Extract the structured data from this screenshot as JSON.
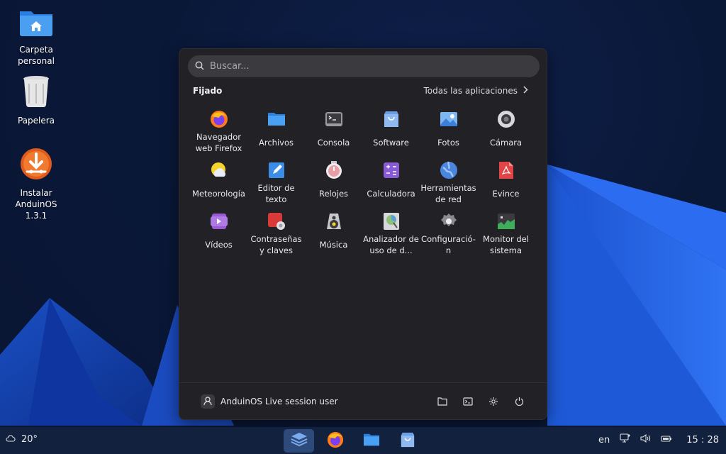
{
  "desktop": {
    "icons": [
      {
        "label": "Carpeta personal",
        "icon": "home-folder-icon"
      },
      {
        "label": "Papelera",
        "icon": "trash-icon"
      },
      {
        "label": "Instalar AnduinOS 1.3.1",
        "icon": "installer-icon"
      }
    ]
  },
  "menu": {
    "search": {
      "placeholder": "Buscar...",
      "value": ""
    },
    "section_title": "Fijado",
    "all_apps_label": "Todas las aplicaciones",
    "apps": [
      {
        "label": "Navegador web Firefox",
        "icon": "firefox-icon"
      },
      {
        "label": "Archivos",
        "icon": "files-icon"
      },
      {
        "label": "Consola",
        "icon": "console-icon"
      },
      {
        "label": "Software",
        "icon": "software-icon"
      },
      {
        "label": "Fotos",
        "icon": "photos-icon"
      },
      {
        "label": "Cámara",
        "icon": "camera-icon"
      },
      {
        "label": "Meteorología",
        "icon": "weather-icon"
      },
      {
        "label": "Editor de texto",
        "icon": "text-editor-icon"
      },
      {
        "label": "Relojes",
        "icon": "clocks-icon"
      },
      {
        "label": "Calculadora",
        "icon": "calculator-icon"
      },
      {
        "label": "Herramientas de red",
        "icon": "network-tools-icon"
      },
      {
        "label": "Evince",
        "icon": "document-viewer-icon"
      },
      {
        "label": "Vídeos",
        "icon": "videos-icon"
      },
      {
        "label": "Contraseñas y claves",
        "icon": "passwords-icon"
      },
      {
        "label": "Música",
        "icon": "music-icon"
      },
      {
        "label": "Analizador de uso de d...",
        "icon": "disk-usage-icon"
      },
      {
        "label": "Configuració-n",
        "icon": "settings-icon"
      },
      {
        "label": "Monitor del sistema",
        "icon": "system-monitor-icon"
      }
    ],
    "user_label": "AnduinOS Live session user",
    "footer_buttons": [
      "folder-icon",
      "terminal-icon",
      "gear-icon",
      "power-icon"
    ]
  },
  "taskbar": {
    "weather_temp": "20°",
    "apps": [
      "app-grid-icon",
      "firefox-icon",
      "files-icon",
      "software-icon"
    ],
    "language": "en",
    "clock": "15 : 28"
  },
  "colors": {
    "accent": "#3584e4",
    "menu_bg": "#222226",
    "taskbar_bg": "#12213d"
  }
}
